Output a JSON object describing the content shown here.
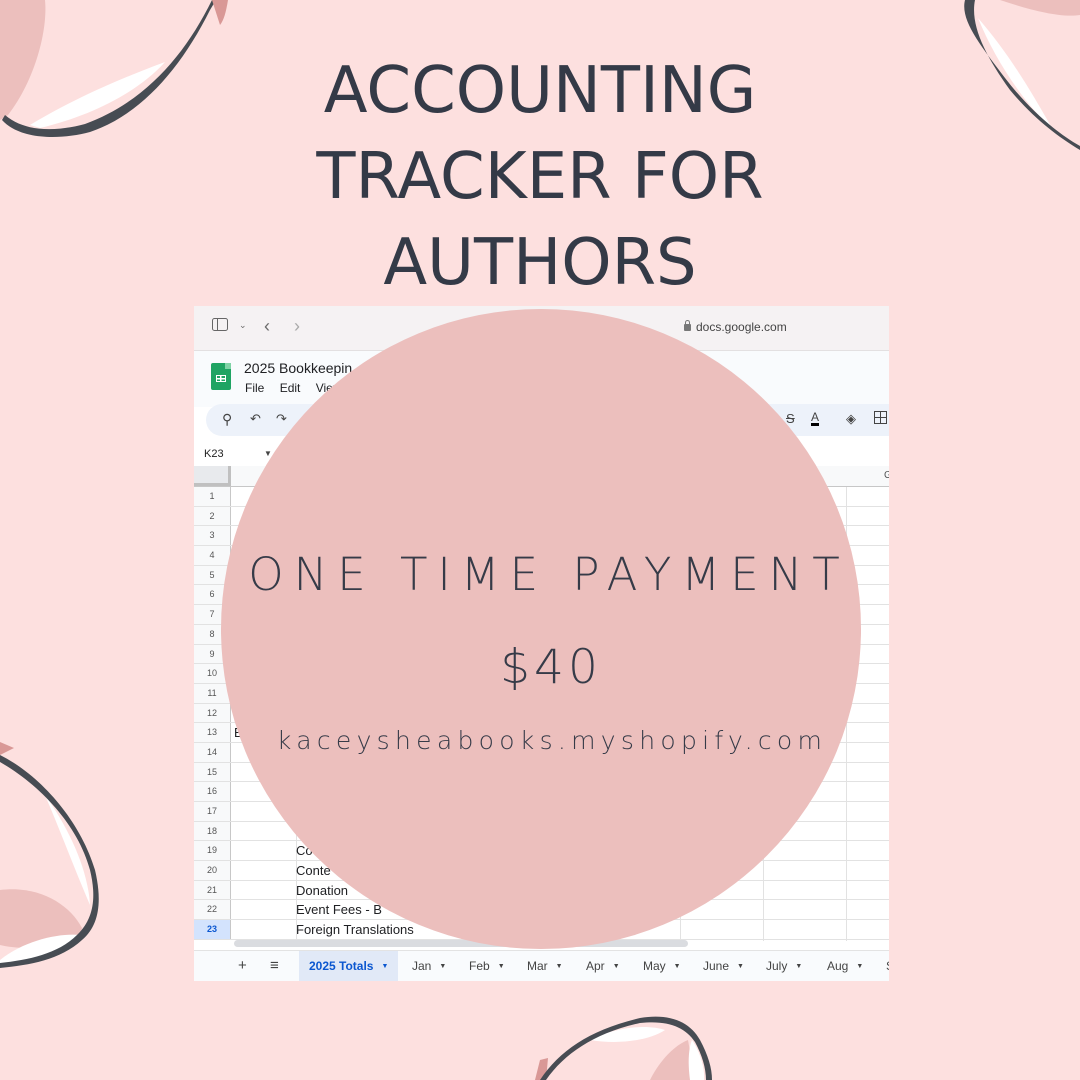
{
  "headline": {
    "lines": [
      "ACCOUNTING",
      "TRACKER FOR",
      "AUTHORS"
    ]
  },
  "offer": {
    "label": "ONE TIME PAYMENT",
    "price": "$40",
    "website": "kaceysheabooks.myshopify.com"
  },
  "colors": {
    "background": "#fde0df",
    "circle": "#ecbfbd",
    "text": "#343a47",
    "sheets_green": "#1fa463",
    "active_tab": "#0b57d0"
  },
  "screenshot": {
    "browser": {
      "url": "docs.google.com",
      "icons": [
        "sidebar-icon",
        "chevron-down-icon",
        "back-icon",
        "forward-icon",
        "lock-icon"
      ]
    },
    "app": {
      "doc_title": "2025 Bookkeepin",
      "menus": [
        "File",
        "Edit",
        "View"
      ]
    },
    "toolbar": {
      "icons": [
        "search-icon",
        "undo-icon",
        "redo-icon",
        "strikethrough-icon",
        "text-color-icon",
        "fill-color-icon",
        "borders-icon"
      ]
    },
    "name_box": "K23",
    "visible_column_letter": "G",
    "rows": [
      {
        "num": "1",
        "a": "",
        "b": ""
      },
      {
        "num": "2",
        "a": "",
        "b": ""
      },
      {
        "num": "3",
        "a": "",
        "b": ""
      },
      {
        "num": "4",
        "a": "",
        "b": ""
      },
      {
        "num": "5",
        "a": "",
        "b": ""
      },
      {
        "num": "6",
        "a": "",
        "b": ""
      },
      {
        "num": "7",
        "a": "",
        "b": ""
      },
      {
        "num": "8",
        "a": "",
        "b": ""
      },
      {
        "num": "9",
        "a": "",
        "b": ""
      },
      {
        "num": "10",
        "a": "",
        "b": ""
      },
      {
        "num": "11",
        "a": "",
        "b": ""
      },
      {
        "num": "12",
        "a": "",
        "b": ""
      },
      {
        "num": "13",
        "a": "E",
        "b": ""
      },
      {
        "num": "14",
        "a": "",
        "b": ""
      },
      {
        "num": "15",
        "a": "",
        "b": ""
      },
      {
        "num": "16",
        "a": "",
        "b": ""
      },
      {
        "num": "17",
        "a": "",
        "b": ""
      },
      {
        "num": "18",
        "a": "",
        "b": ""
      },
      {
        "num": "19",
        "a": "",
        "b": "Co"
      },
      {
        "num": "20",
        "a": "",
        "b": "Conte"
      },
      {
        "num": "21",
        "a": "",
        "b": "Donation"
      },
      {
        "num": "22",
        "a": "",
        "b": "Event Fees - B"
      },
      {
        "num": "23",
        "a": "",
        "b": "Foreign Translations"
      }
    ],
    "selected_row": "23",
    "tab_controls": {
      "add": "+",
      "all_sheets": "≡"
    },
    "tabs": [
      "2025 Totals",
      "Jan",
      "Feb",
      "Mar",
      "Apr",
      "May",
      "June",
      "July",
      "Aug",
      "S"
    ],
    "active_tab": "2025 Totals"
  }
}
